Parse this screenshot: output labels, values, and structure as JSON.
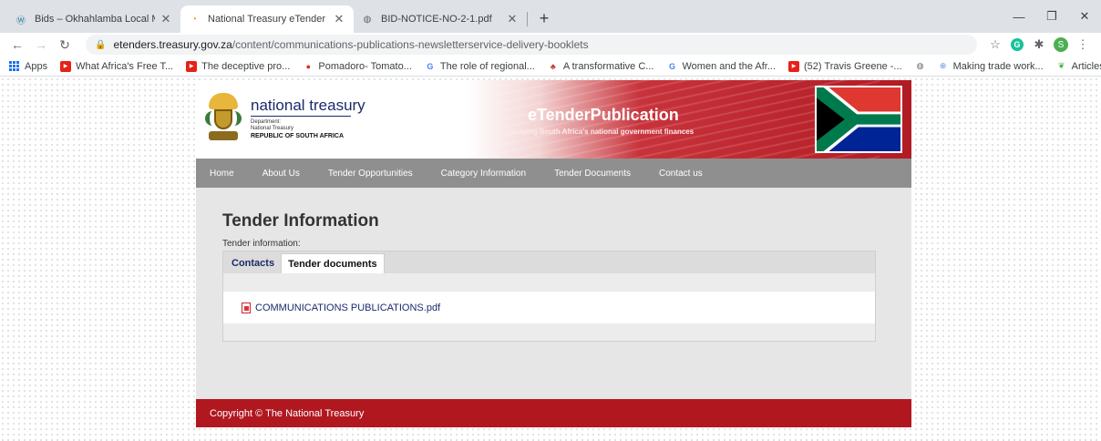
{
  "browser": {
    "tabs": [
      {
        "title": "Bids – Okhahlamba Local Municip",
        "icon": "wordpress-icon"
      },
      {
        "title": "National Treasury eTender",
        "icon": "etender-icon",
        "active": true
      },
      {
        "title": "BID-NOTICE-NO-2-1.pdf",
        "icon": "globe-icon"
      }
    ],
    "url_host": "etenders.treasury.gov.za",
    "url_path": "/content/communications-publications-newsletterservice-delivery-booklets",
    "profile_initial": "S",
    "bookmarks": [
      {
        "label": "Apps",
        "icon": "apps-icon"
      },
      {
        "label": "What Africa's Free T...",
        "icon": "youtube-icon"
      },
      {
        "label": "The deceptive pro...",
        "icon": "youtube-icon"
      },
      {
        "label": "Pomadoro- Tomato...",
        "icon": "tomato-icon"
      },
      {
        "label": "The role of regional...",
        "icon": "google-icon"
      },
      {
        "label": "A transformative C...",
        "icon": "tree-icon"
      },
      {
        "label": "Women and the Afr...",
        "icon": "google-icon"
      },
      {
        "label": "(52) Travis Greene -...",
        "icon": "youtube-icon"
      },
      {
        "label": "",
        "icon": "globe-icon"
      },
      {
        "label": "Making trade work...",
        "icon": "un-icon"
      },
      {
        "label": "Articles of Agreeme...",
        "icon": "leaf-icon"
      }
    ],
    "more_label": "»"
  },
  "site": {
    "logo": {
      "name": "national treasury",
      "dept1": "Department:",
      "dept2": "National Treasury",
      "country": "REPUBLIC OF SOUTH AFRICA"
    },
    "title": "eTenderPublication",
    "tagline": "managing South Africa's national government finances",
    "nav": [
      "Home",
      "About Us",
      "Tender Opportunities",
      "Category Information",
      "Tender Documents",
      "Contact us"
    ],
    "heading": "Tender Information",
    "sub_label": "Tender information:",
    "tabs": {
      "contacts": "Contacts",
      "documents": "Tender documents"
    },
    "document": "COMMUNICATIONS PUBLICATIONS.pdf",
    "footer": "Copyright © The National Treasury"
  }
}
